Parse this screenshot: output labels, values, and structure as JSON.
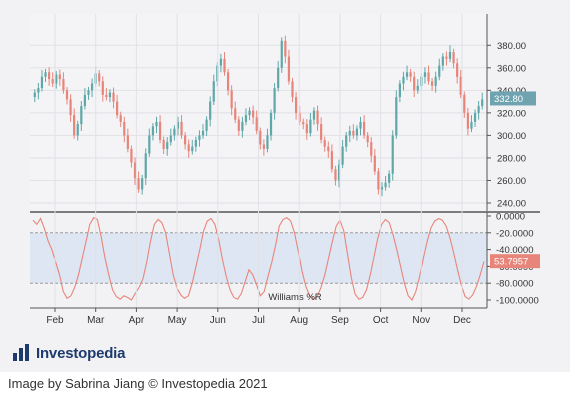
{
  "chart_data": [
    {
      "type": "candlestick",
      "panel": "price",
      "x_months": [
        "Feb",
        "Mar",
        "Apr",
        "May",
        "Jun",
        "Jul",
        "Aug",
        "Sep",
        "Oct",
        "Nov",
        "Dec"
      ],
      "ylim": [
        240,
        390
      ],
      "y_ticks": [
        "380.00",
        "360.00",
        "340.00",
        "320.00",
        "300.00",
        "280.00",
        "260.00",
        "240.00"
      ],
      "last_price_label": "332.80",
      "last_price": 332.8,
      "up_color": "#5fa8a8",
      "down_color": "#e8857a",
      "closes": [
        338,
        342,
        352,
        356,
        350,
        346,
        354,
        350,
        340,
        332,
        318,
        300,
        310,
        326,
        336,
        340,
        346,
        355,
        348,
        336,
        334,
        338,
        330,
        318,
        312,
        300,
        288,
        276,
        262,
        252,
        262,
        284,
        300,
        308,
        312,
        296,
        288,
        294,
        300,
        306,
        312,
        300,
        292,
        286,
        290,
        296,
        300,
        304,
        314,
        330,
        348,
        362,
        368,
        356,
        340,
        324,
        314,
        304,
        312,
        318,
        322,
        316,
        304,
        292,
        288,
        300,
        320,
        342,
        360,
        384,
        370,
        348,
        334,
        320,
        312,
        310,
        302,
        314,
        322,
        310,
        296,
        290,
        286,
        270,
        260,
        274,
        290,
        300,
        304,
        300,
        306,
        312,
        300,
        294,
        282,
        268,
        252,
        254,
        258,
        266,
        300,
        334,
        346,
        352,
        356,
        352,
        340,
        344,
        352,
        356,
        348,
        344,
        352,
        362,
        370,
        368,
        374,
        364,
        352,
        336,
        320,
        306,
        312,
        320,
        326,
        332
      ],
      "grid": true
    },
    {
      "type": "line",
      "panel": "oscillator",
      "title": "Williams %R",
      "ylim": [
        -100,
        0
      ],
      "y_ticks": [
        "0.0000",
        "-20.0000",
        "-40.0000",
        "-60.0000",
        "-80.0000",
        "-100.0000"
      ],
      "overbought": -20,
      "oversold": -80,
      "last_value_label": "53.7957",
      "last_value": -53.7957,
      "line_color": "#e8857a",
      "values": [
        -5,
        -10,
        -3,
        -15,
        -30,
        -40,
        -55,
        -70,
        -90,
        -98,
        -95,
        -85,
        -70,
        -50,
        -30,
        -10,
        -2,
        -4,
        -25,
        -50,
        -70,
        -88,
        -96,
        -99,
        -95,
        -97,
        -100,
        -92,
        -85,
        -75,
        -55,
        -30,
        -10,
        -4,
        -8,
        -20,
        -45,
        -70,
        -86,
        -94,
        -98,
        -95,
        -80,
        -60,
        -40,
        -18,
        -6,
        -3,
        -10,
        -28,
        -52,
        -72,
        -88,
        -97,
        -99,
        -92,
        -78,
        -64,
        -70,
        -82,
        -95,
        -90,
        -72,
        -55,
        -35,
        -12,
        -4,
        -2,
        -6,
        -20,
        -42,
        -66,
        -84,
        -95,
        -99,
        -96,
        -85,
        -70,
        -50,
        -30,
        -12,
        -5,
        -18,
        -46,
        -74,
        -93,
        -99,
        -97,
        -88,
        -70,
        -48,
        -26,
        -10,
        -4,
        -8,
        -22,
        -40,
        -60,
        -80,
        -95,
        -100,
        -90,
        -72,
        -50,
        -30,
        -14,
        -6,
        -3,
        -5,
        -12,
        -26,
        -44,
        -64,
        -82,
        -96,
        -99,
        -94,
        -84,
        -70,
        -54
      ],
      "grid": true
    }
  ],
  "caption": "Image by Sabrina Jiang © Investopedia 2021",
  "logo_text": "Investopedia"
}
